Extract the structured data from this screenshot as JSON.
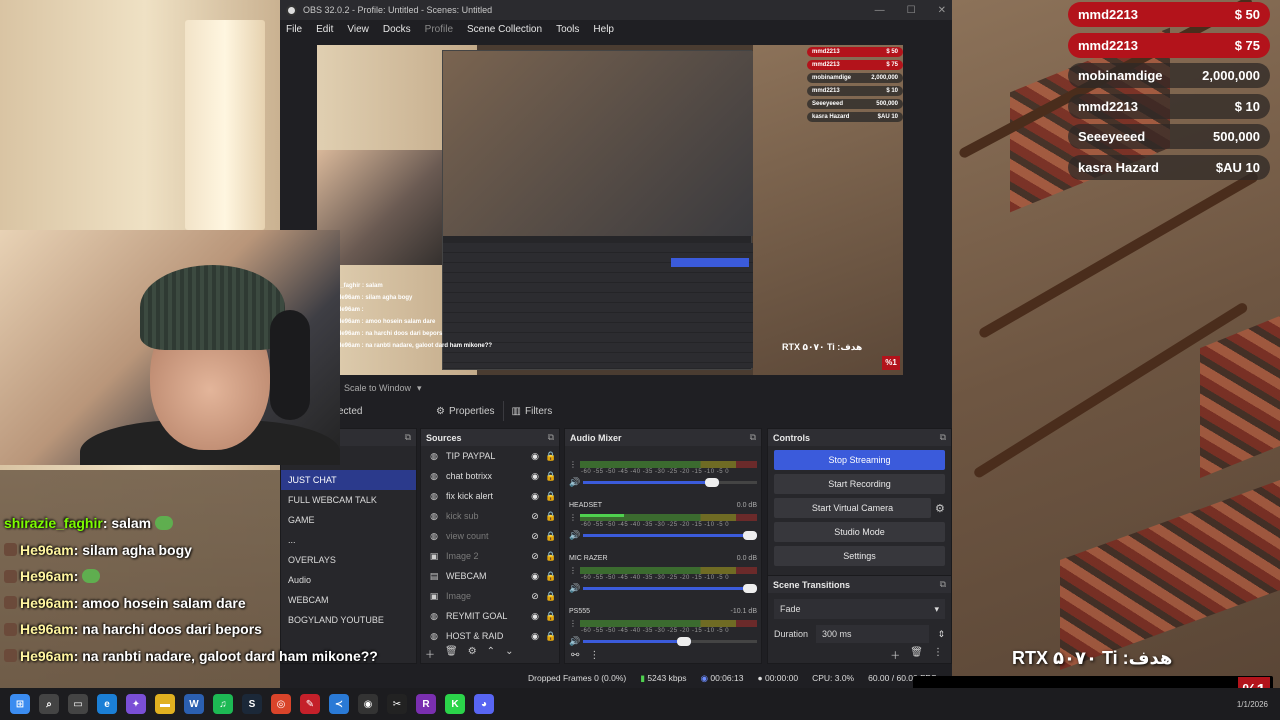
{
  "window": {
    "title": "OBS 32.0.2 - Profile: Untitled - Scenes: Untitled"
  },
  "menu": [
    "File",
    "Edit",
    "View",
    "Docks",
    "Profile",
    "Scene Collection",
    "Tools",
    "Help"
  ],
  "preview": {
    "scale_label": "Scale to Window",
    "donations": [
      {
        "name": "mmd2213",
        "amount": "$ 50",
        "style": "red"
      },
      {
        "name": "mmd2213",
        "amount": "$ 75",
        "style": "red"
      },
      {
        "name": "mobinamdige",
        "amount": "2,000,000",
        "style": "dark"
      },
      {
        "name": "mmd2213",
        "amount": "$ 10",
        "style": "dark"
      },
      {
        "name": "Seeeyeeed",
        "amount": "500,000",
        "style": "dark"
      },
      {
        "name": "kasra Hazard",
        "amount": "$AU 10",
        "style": "dark"
      }
    ],
    "chat": [
      "c_faghir : salam",
      "He96am : silam agha bogy",
      "He96am :",
      "He96am : amoo hosein salam dare",
      "He96am : na harchi doos dari bepors",
      "He96am : na ranbti nadare, galoot dard ham mikone??"
    ],
    "goal": "RTX ۵۰۷۰ Ti :هدف",
    "pct": "%1"
  },
  "tabs": {
    "selected": "ected",
    "properties": "Properties",
    "filters": "Filters"
  },
  "scenes": {
    "items": [
      "JUST CHAT",
      "FULL WEBCAM TALK",
      "GAME",
      "...",
      "OVERLAYS",
      "Audio",
      "WEBCAM",
      "BOGYLAND YOUTUBE"
    ]
  },
  "sources": {
    "title": "Sources",
    "items": [
      {
        "name": "TIP PAYPAL",
        "icon": "◍",
        "visible": true
      },
      {
        "name": "chat botrixx",
        "icon": "◍",
        "visible": true
      },
      {
        "name": "fix kick alert",
        "icon": "◍",
        "visible": true
      },
      {
        "name": "kick sub",
        "icon": "◍",
        "visible": false
      },
      {
        "name": "view count",
        "icon": "◍",
        "visible": false
      },
      {
        "name": "Image 2",
        "icon": "▣",
        "visible": false
      },
      {
        "name": "WEBCAM",
        "icon": "▤",
        "visible": true
      },
      {
        "name": "Image",
        "icon": "▣",
        "visible": false
      },
      {
        "name": "REYMIT GOAL",
        "icon": "◍",
        "visible": true
      },
      {
        "name": "HOST & RAID",
        "icon": "◍",
        "visible": true
      }
    ]
  },
  "mixer": {
    "title": "Audio Mixer",
    "scale": "-60 -55 -50 -45 -40 -35 -30 -25 -20 -15 -10 -5 0",
    "channels": [
      {
        "name": "",
        "db": "",
        "level": 0,
        "volume": 0.78
      },
      {
        "name": "HEADSET",
        "db": "0.0 dB",
        "level": 0.25,
        "volume": 1.0
      },
      {
        "name": "MIC RAZER",
        "db": "0.0 dB",
        "level": 0.0,
        "volume": 1.0
      },
      {
        "name": "PS555",
        "db": "-10.1 dB",
        "level": 0.0,
        "volume": 0.62
      }
    ]
  },
  "controls": {
    "title": "Controls",
    "stop_streaming": "Stop Streaming",
    "start_recording": "Start Recording",
    "start_virtual_camera": "Start Virtual Camera",
    "studio_mode": "Studio Mode",
    "settings": "Settings"
  },
  "transitions": {
    "title": "Scene Transitions",
    "selected": "Fade",
    "duration_label": "Duration",
    "duration": "300 ms"
  },
  "status": {
    "dropped": "Dropped Frames 0 (0.0%)",
    "bitrate": "5243 kbps",
    "stream_time": "00:06:13",
    "rec_time": "00:00:00",
    "cpu": "CPU: 3.0%",
    "fps": "60.00 / 60.00 FPS"
  },
  "stream_chat": [
    {
      "user": "shirazie_faghir",
      "msg": " : salam",
      "emote": true,
      "badge": false
    },
    {
      "user": "He96am",
      "msg": " : silam agha bogy",
      "emote": false,
      "badge": true
    },
    {
      "user": "He96am",
      "msg": " :",
      "emote": true,
      "badge": true
    },
    {
      "user": "He96am",
      "msg": " : amoo hosein salam dare",
      "emote": false,
      "badge": true
    },
    {
      "user": "He96am",
      "msg": " : na harchi doos dari bepors",
      "emote": false,
      "badge": true
    },
    {
      "user": "He96am",
      "msg": " : na ranbti nadare, galoot dard ham mikone??",
      "emote": false,
      "badge": true
    }
  ],
  "donations": [
    {
      "name": "mmd2213",
      "amount": "$ 50",
      "style": "red"
    },
    {
      "name": "mmd2213",
      "amount": "$ 75",
      "style": "red"
    },
    {
      "name": "mobinamdige",
      "amount": "2,000,000",
      "style": "dark"
    },
    {
      "name": "mmd2213",
      "amount": "$ 10",
      "style": "dark"
    },
    {
      "name": "Seeeyeeed",
      "amount": "500,000",
      "style": "dark"
    },
    {
      "name": "kasra Hazard",
      "amount": "$AU 10",
      "style": "dark"
    }
  ],
  "goal": {
    "text": "RTX ۵۰۷۰ Ti :هدف",
    "pct": "%1"
  },
  "taskbar": {
    "date": "1/1/2026",
    "icons": [
      {
        "name": "windows-start-icon",
        "glyph": "⊞",
        "color": "#3b8cf0"
      },
      {
        "name": "search-icon",
        "glyph": "⌕",
        "color": "#444"
      },
      {
        "name": "task-view-icon",
        "glyph": "▭",
        "color": "#444"
      },
      {
        "name": "edge-icon",
        "glyph": "e",
        "color": "#1b7fd6"
      },
      {
        "name": "copilot-icon",
        "glyph": "✦",
        "color": "#7a4fd6"
      },
      {
        "name": "file-explorer-icon",
        "glyph": "▬",
        "color": "#e0b020"
      },
      {
        "name": "word-icon",
        "glyph": "W",
        "color": "#2b5fb0"
      },
      {
        "name": "spotify-icon",
        "glyph": "♫",
        "color": "#1db954"
      },
      {
        "name": "steam-icon",
        "glyph": "S",
        "color": "#1b2838"
      },
      {
        "name": "chrome-icon",
        "glyph": "◎",
        "color": "#d9442a"
      },
      {
        "name": "app-red-icon",
        "glyph": "✎",
        "color": "#c4202a"
      },
      {
        "name": "vscode-icon",
        "glyph": "≺",
        "color": "#2a7ad6"
      },
      {
        "name": "obs-icon",
        "glyph": "◉",
        "color": "#333"
      },
      {
        "name": "capcut-icon",
        "glyph": "✂",
        "color": "#222"
      },
      {
        "name": "rider-icon",
        "glyph": "R",
        "color": "#7a2fb0"
      },
      {
        "name": "kick-icon",
        "glyph": "K",
        "color": "#2bd44a"
      },
      {
        "name": "discord-icon",
        "glyph": "◕",
        "color": "#5865f2"
      }
    ]
  }
}
